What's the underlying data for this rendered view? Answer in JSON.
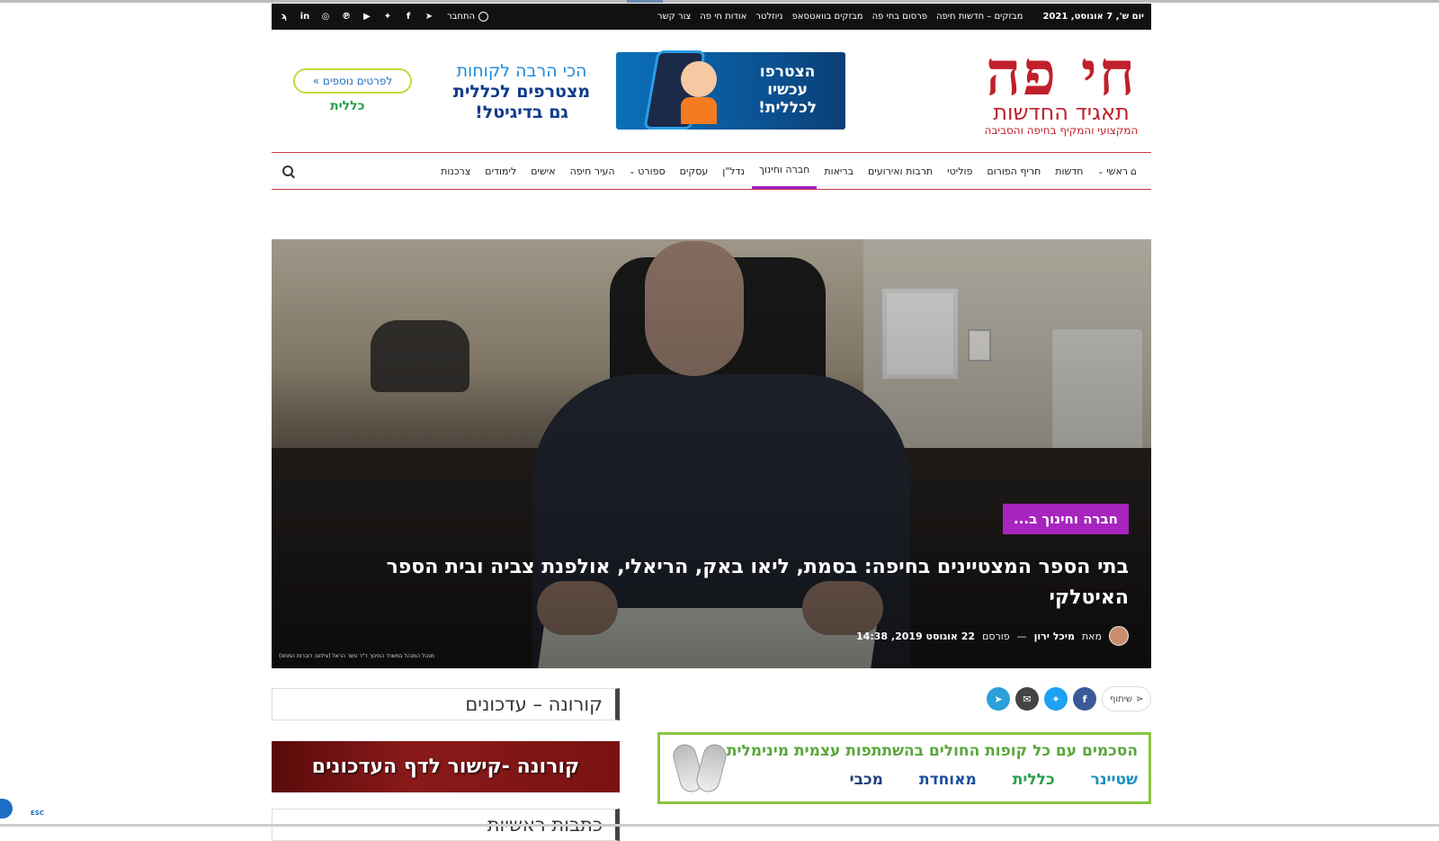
{
  "topbar": {
    "date": "יום ש', 7 אוגוסט, 2021",
    "links": [
      "מבזקים – חדשות חיפה",
      "פרסום בחי פה",
      "מבזקים בוואטסאפ",
      "ניוזלטר",
      "אודות חי פה",
      "צור קשר"
    ],
    "login": "התחבר",
    "social": [
      "rss",
      "in",
      "instagram",
      "pinterest",
      "youtube",
      "twitter",
      "f",
      "telegram"
    ]
  },
  "logo": {
    "big": "חי פה",
    "sub1": "תאגיד החדשות",
    "sub2": "המקצועי והמקיף בחיפה והסביבה"
  },
  "banner": {
    "phone_text": [
      "הצטרפו",
      "עכשיו",
      "לכללית!"
    ],
    "mid_l1": "הכי הרבה לקוחות",
    "mid_l2": "מצטרפים לכללית",
    "mid_l3": "גם בדיגיטל!",
    "cta": "לפרטים נוספים »",
    "brand": "כללית"
  },
  "nav": {
    "items": [
      "ראשי",
      "חדשות",
      "חריף הפורום",
      "פוליטי",
      "תרבות ואירועים",
      "בריאות",
      "חברה וחינוך",
      "נדל\"ן",
      "עסקים",
      "ספורט",
      "העיר חיפה",
      "אישים",
      "לימודים",
      "צרכנות"
    ],
    "active": "חברה וחינוך"
  },
  "hero": {
    "category": "חברה וחינוך ב...",
    "title": "בתי הספר המצטיינים בחיפה: בסמת, ליאו באק, הריאלי, אולפנת צביה ובית הספר האיטלקי",
    "by": "מאת",
    "author": "מיכל ירון",
    "published": "פורסם",
    "date": "22 אוגוסט 2019, 14:38",
    "credit": "מנהל המנהל במשרד החינוך ד\"ר טשר הראל (צילום: דוברות המחוז)"
  },
  "share": {
    "label": "שיתוף"
  },
  "ad2": {
    "headline": "הסכמים עם כל קופות החולים בהשתתפות עצמית מינימלית",
    "logos": [
      "שטיינר",
      "כללית",
      "מאוחדת",
      "מכבי"
    ]
  },
  "sidebar": {
    "title1": "קורונה – עדכונים",
    "banner": "קורונה -קישור לדף העדכונים",
    "title2": "כתבות ראשיות"
  },
  "esc": "ESC",
  "colors": {
    "brand_red": "#c0202a",
    "nav_accent": "#a020c0",
    "category_bg": "#a724bf"
  }
}
